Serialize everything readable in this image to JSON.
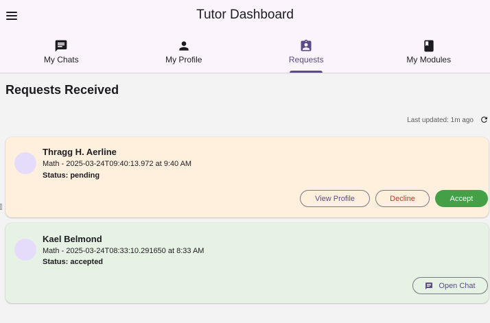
{
  "header": {
    "title": "Tutor Dashboard",
    "menu_icon": "hamburger-menu-icon"
  },
  "tabs": [
    {
      "label": "My Chats",
      "icon": "chat-icon",
      "active": false
    },
    {
      "label": "My Profile",
      "icon": "person-icon",
      "active": false
    },
    {
      "label": "Requests",
      "icon": "clipboard-person-icon",
      "active": true
    },
    {
      "label": "My Modules",
      "icon": "book-icon",
      "active": false
    }
  ],
  "main": {
    "heading": "Requests Received",
    "last_updated": "Last updated: 1m ago",
    "refresh_icon": "refresh-icon"
  },
  "requests": [
    {
      "name": "Thragg H. Aerline",
      "detail": "Math - 2025-03-24T09:40:13.972 at 9:40 AM",
      "status": "Status: pending",
      "buttons": {
        "view": "View Profile",
        "decline": "Decline",
        "accept": "Accept"
      }
    },
    {
      "name": "Kael Belmond",
      "detail": "Math - 2025-03-24T08:33:10.291650 at 8:33 AM",
      "status": "Status: accepted",
      "buttons": {
        "chat": "Open Chat"
      }
    }
  ],
  "colors": {
    "appbar_bg": "#fbf4fd",
    "accent": "#5b4a8a",
    "pending_card": "#fff0de",
    "accepted_card": "#e6f2e4",
    "accept_button": "#43a047",
    "decline_text": "#c9302c",
    "avatar": "#e5dcfb"
  }
}
